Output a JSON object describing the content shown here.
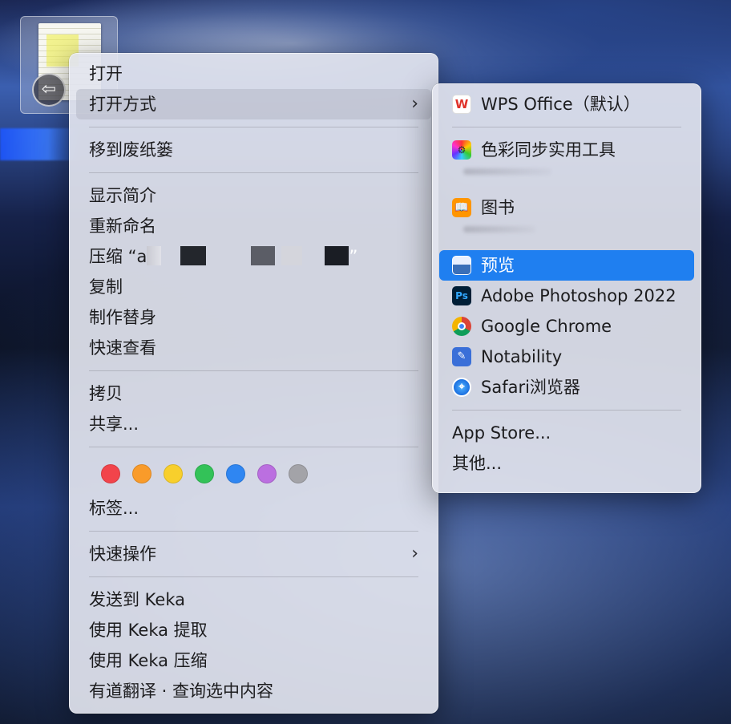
{
  "main_menu": {
    "open": "打开",
    "open_with": "打开方式",
    "trash": "移到废纸篓",
    "get_info": "显示简介",
    "rename": "重新命名",
    "compress_prefix": "压缩 “a",
    "compress_suffix": "”",
    "duplicate": "复制",
    "make_alias": "制作替身",
    "quick_look": "快速查看",
    "copy": "拷贝",
    "share": "共享...",
    "tags": "标签...",
    "quick_actions": "快速操作",
    "send_to_keka": "发送到 Keka",
    "extract_with_keka": "使用 Keka 提取",
    "compress_with_keka": "使用 Keka 压缩",
    "youdao_translate": "有道翻译 · 查询选中内容"
  },
  "tag_colors": [
    "#f2444b",
    "#f99b2a",
    "#f8cf2c",
    "#33c258",
    "#2f86f2",
    "#bb6fe0",
    "#a3a3a8"
  ],
  "submenu": {
    "wps": "WPS Office（默认）",
    "colorsync": "色彩同步实用工具",
    "books": "图书",
    "preview": "预览",
    "photoshop": "Adobe Photoshop 2022",
    "chrome": "Google Chrome",
    "notability": "Notability",
    "safari": "Safari浏览器",
    "app_store": "App Store...",
    "other": "其他..."
  },
  "icons": {
    "chevron": "›",
    "back": "⇦",
    "wps": "W",
    "colorsync": "⚙",
    "books": "📖",
    "ps": "Ps",
    "notability": "✎",
    "safari": "⌖"
  }
}
